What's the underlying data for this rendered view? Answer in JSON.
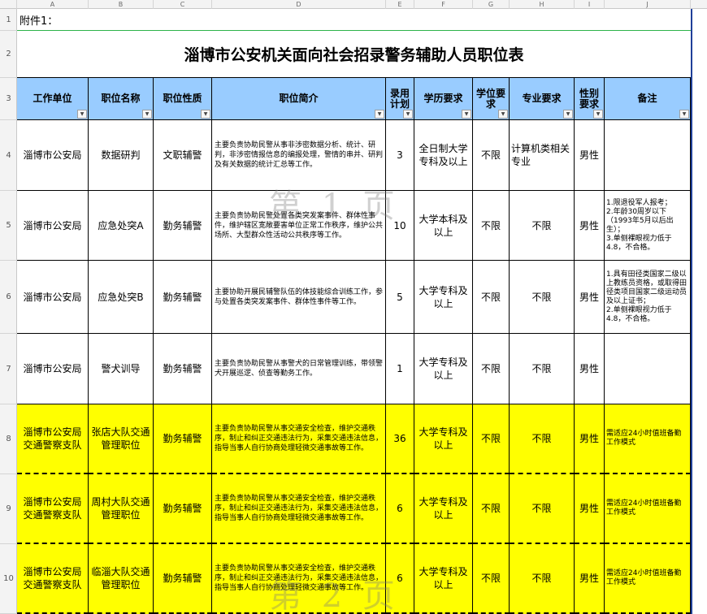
{
  "col_headers": [
    "A",
    "B",
    "C",
    "D",
    "E",
    "F",
    "G",
    "H",
    "I",
    "J"
  ],
  "row_headers": [
    "1",
    "2",
    "3",
    "4",
    "5",
    "6",
    "7",
    "8",
    "9",
    "10"
  ],
  "row1_text": "附件1：",
  "title": "淄博市公安机关面向社会招录警务辅助人员职位表",
  "headers": [
    "工作单位",
    "职位名称",
    "职位性质",
    "职位简介",
    "录用计划",
    "学历要求",
    "学位要求",
    "专业要求",
    "性别要求",
    "备注"
  ],
  "dropdown_glyph": "▼",
  "rows": [
    {
      "unit": "淄博市公安局",
      "name": "数据研判",
      "type": "文职辅警",
      "desc": "主要负责协助民警从事非涉密数据分析、统计、研判，非涉密情报信息的编报处理，警情的串并、研判及有关数据的统计汇总等工作。",
      "plan": "3",
      "edu": "全日制大学专科及以上",
      "degree": "不限",
      "major": "计算机类相关专业",
      "gender": "男性",
      "note": ""
    },
    {
      "unit": "淄博市公安局",
      "name": "应急处突A",
      "type": "勤务辅警",
      "desc": "主要负责协助民警处置各类突发案事件、群体性事件，维护辖区宽敞要害单位正常工作秩序，维护公共场所、大型群众性活动公共秩序等工作。",
      "plan": "10",
      "edu": "大学本科及以上",
      "degree": "不限",
      "major": "不限",
      "gender": "男性",
      "note": "1.限退役军人报考；\n2.年龄30周岁以下（1993年5月以后出生）；\n3.单侧裸眼视力低于4.8，不合格。"
    },
    {
      "unit": "淄博市公安局",
      "name": "应急处突B",
      "type": "勤务辅警",
      "desc": "主要协助开展民辅警队伍的体技能综合训练工作，参与处置各类突发案事件、群体性事件等工作。",
      "plan": "5",
      "edu": "大学专科及以上",
      "degree": "不限",
      "major": "不限",
      "gender": "男性",
      "note": "1.具有田径类国家二级以上教练员资格，或取得田径类项目国家二级运动员及以上证书；\n2.单侧裸眼视力低于4.8，不合格。"
    },
    {
      "unit": "淄博市公安局",
      "name": "警犬训导",
      "type": "勤务辅警",
      "desc": "主要负责协助民警从事警犬的日常管理训练，带领警犬开展巡逻、侦查等勤务工作。",
      "plan": "1",
      "edu": "大学专科及以上",
      "degree": "不限",
      "major": "不限",
      "gender": "男性",
      "note": ""
    },
    {
      "unit": "淄博市公安局交通警察支队",
      "name": "张店大队交通管理职位",
      "type": "勤务辅警",
      "desc": "主要负责协助民警从事交通安全检查，维护交通秩序，制止和纠正交通违法行为，采集交通违法信息，指导当事人自行协商处理轻微交通事故等工作。",
      "plan": "36",
      "edu": "大学专科及以上",
      "degree": "不限",
      "major": "不限",
      "gender": "男性",
      "note": "需适应24小时值班备勤工作模式"
    },
    {
      "unit": "淄博市公安局交通警察支队",
      "name": "周村大队交通管理职位",
      "type": "勤务辅警",
      "desc": "主要负责协助民警从事交通安全检查，维护交通秩序，制止和纠正交通违法行为，采集交通违法信息，指导当事人自行协商处理轻微交通事故等工作。",
      "plan": "6",
      "edu": "大学专科及以上",
      "degree": "不限",
      "major": "不限",
      "gender": "男性",
      "note": "需适应24小时值班备勤工作模式"
    },
    {
      "unit": "淄博市公安局交通警察支队",
      "name": "临淄大队交通管理职位",
      "type": "勤务辅警",
      "desc": "主要负责协助民警从事交通安全检查，维护交通秩序，制止和纠正交通违法行为，采集交通违法信息，指导当事人自行协商处理轻微交通事故等工作。",
      "plan": "6",
      "edu": "大学专科及以上",
      "degree": "不限",
      "major": "不限",
      "gender": "男性",
      "note": "需适应24小时值班备勤工作模式"
    }
  ],
  "watermarks": [
    "第 1 页",
    "第 2 页"
  ],
  "colors": {
    "header_bg": "#99ccff",
    "highlight": "#ffff00",
    "grid": "#000000",
    "frame": "#1f3f99"
  }
}
